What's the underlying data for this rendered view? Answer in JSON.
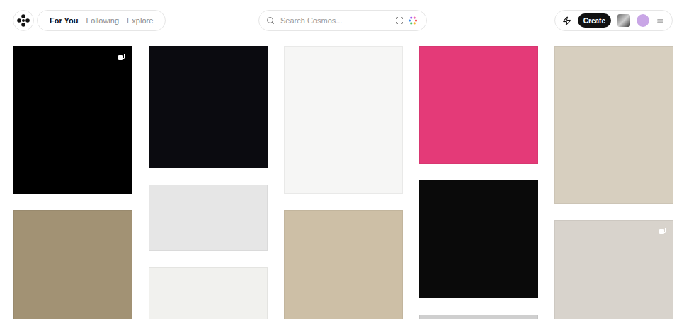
{
  "nav": {
    "tabs": [
      {
        "label": "For You",
        "selected": true
      },
      {
        "label": "Following",
        "selected": false
      },
      {
        "label": "Explore",
        "selected": false
      }
    ]
  },
  "search": {
    "placeholder": "Search Cosmos..."
  },
  "actions": {
    "create": "Create"
  },
  "feed": {
    "columns": [
      [
        {
          "collection": true,
          "color": "#000000"
        },
        {
          "collection": false,
          "color": "#a29274"
        }
      ],
      [
        {
          "collection": false,
          "color": "#0b0b10"
        },
        {
          "collection": false,
          "color": "#e6e6e6"
        },
        {
          "collection": false,
          "color": "#f1f1ee"
        }
      ],
      [
        {
          "collection": false,
          "color": "#f6f6f5"
        },
        {
          "collection": false,
          "color": "#cdbfa6"
        }
      ],
      [
        {
          "collection": false,
          "color": "#e43a78"
        },
        {
          "collection": false,
          "color": "#0a0a0a"
        },
        {
          "collection": false,
          "color": "#cfcfcf"
        }
      ],
      [
        {
          "collection": false,
          "color": "#d7cfbf"
        },
        {
          "collection": true,
          "color": "#d8d3cc"
        }
      ]
    ]
  }
}
